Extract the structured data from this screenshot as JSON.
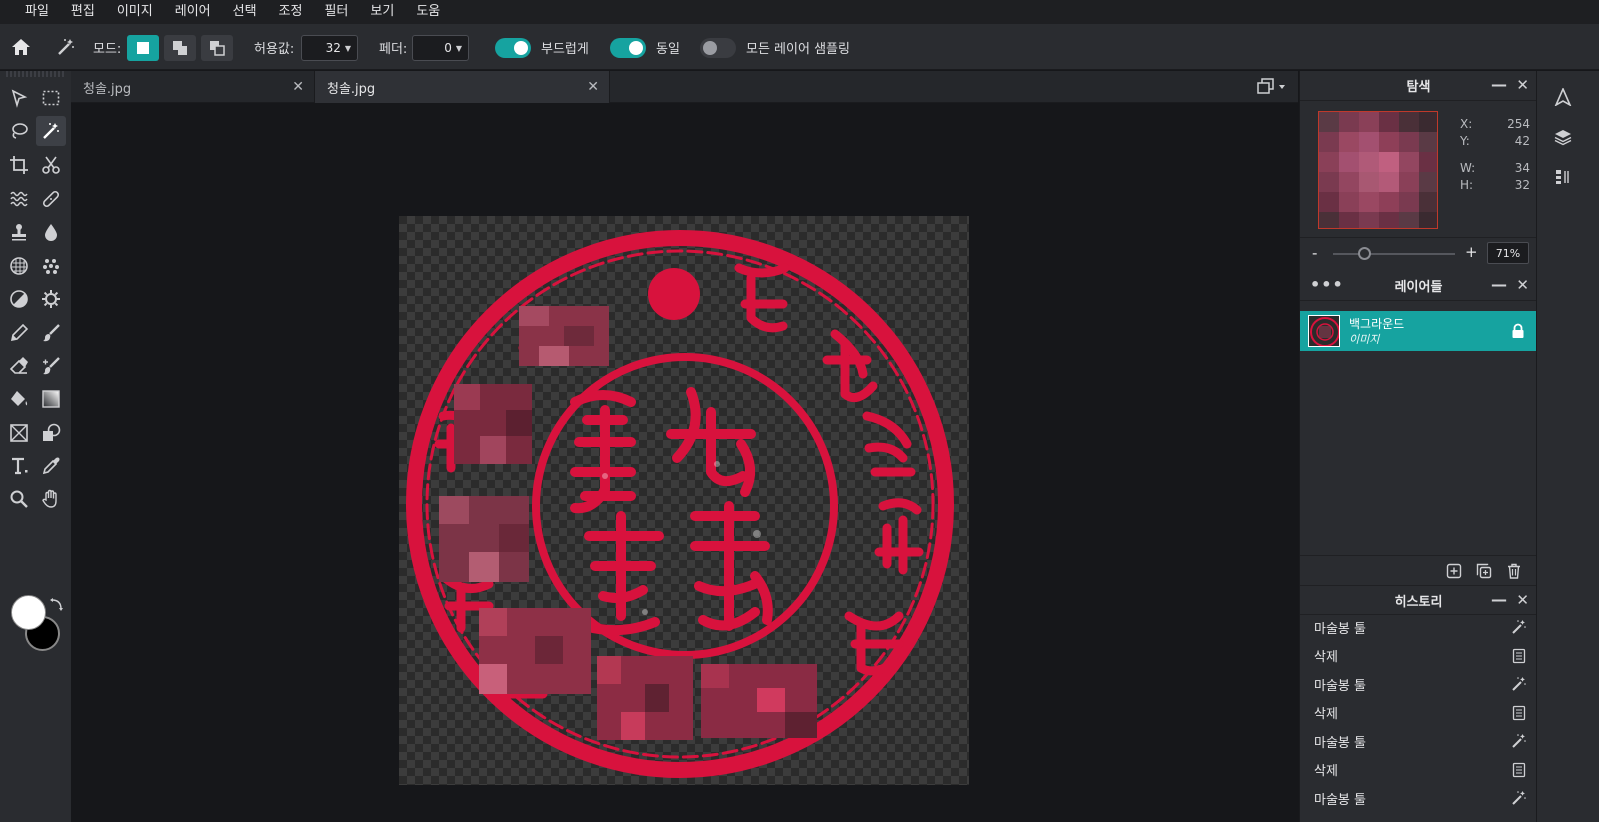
{
  "menu": [
    "파일",
    "편집",
    "이미지",
    "레이어",
    "선택",
    "조정",
    "필터",
    "보기",
    "도움"
  ],
  "options": {
    "mode_label": "모드:",
    "tolerance_label": "허용값:",
    "tolerance_value": "32",
    "feather_label": "페더:",
    "feather_value": "0",
    "smooth_label": "부드럽게",
    "smooth_on": true,
    "contiguous_label": "동일",
    "contiguous_on": true,
    "sample_all_label": "모든 레이어 샘플링",
    "sample_all_on": false
  },
  "tabs": [
    {
      "label": "청솔.jpg",
      "active": false
    },
    {
      "label": "청솔.jpg",
      "active": true
    }
  ],
  "colors": {
    "accent": "#16a3a0",
    "foreground": "#ffffff",
    "background": "#000000",
    "stamp_red": "#d8123d"
  },
  "navigator": {
    "title": "탐색",
    "x_label": "X:",
    "x_value": "254",
    "y_label": "Y:",
    "y_value": "42",
    "w_label": "W:",
    "w_value": "34",
    "h_label": "H:",
    "h_value": "32",
    "zoom_minus": "-",
    "zoom_plus": "+",
    "zoom_value": "71%"
  },
  "layers": {
    "title": "레이어들",
    "items": [
      {
        "name": "백그라운드",
        "type": "이미지",
        "locked": true
      }
    ]
  },
  "history": {
    "title": "히스토리",
    "items": [
      {
        "label": "마술봉 툴",
        "icon": "magic-wand-icon"
      },
      {
        "label": "삭제",
        "icon": "document-icon"
      },
      {
        "label": "마술봉 툴",
        "icon": "magic-wand-icon"
      },
      {
        "label": "삭제",
        "icon": "document-icon"
      },
      {
        "label": "마술봉 툴",
        "icon": "magic-wand-icon"
      },
      {
        "label": "삭제",
        "icon": "document-icon"
      },
      {
        "label": "마술봉 툴",
        "icon": "magic-wand-icon"
      }
    ]
  }
}
